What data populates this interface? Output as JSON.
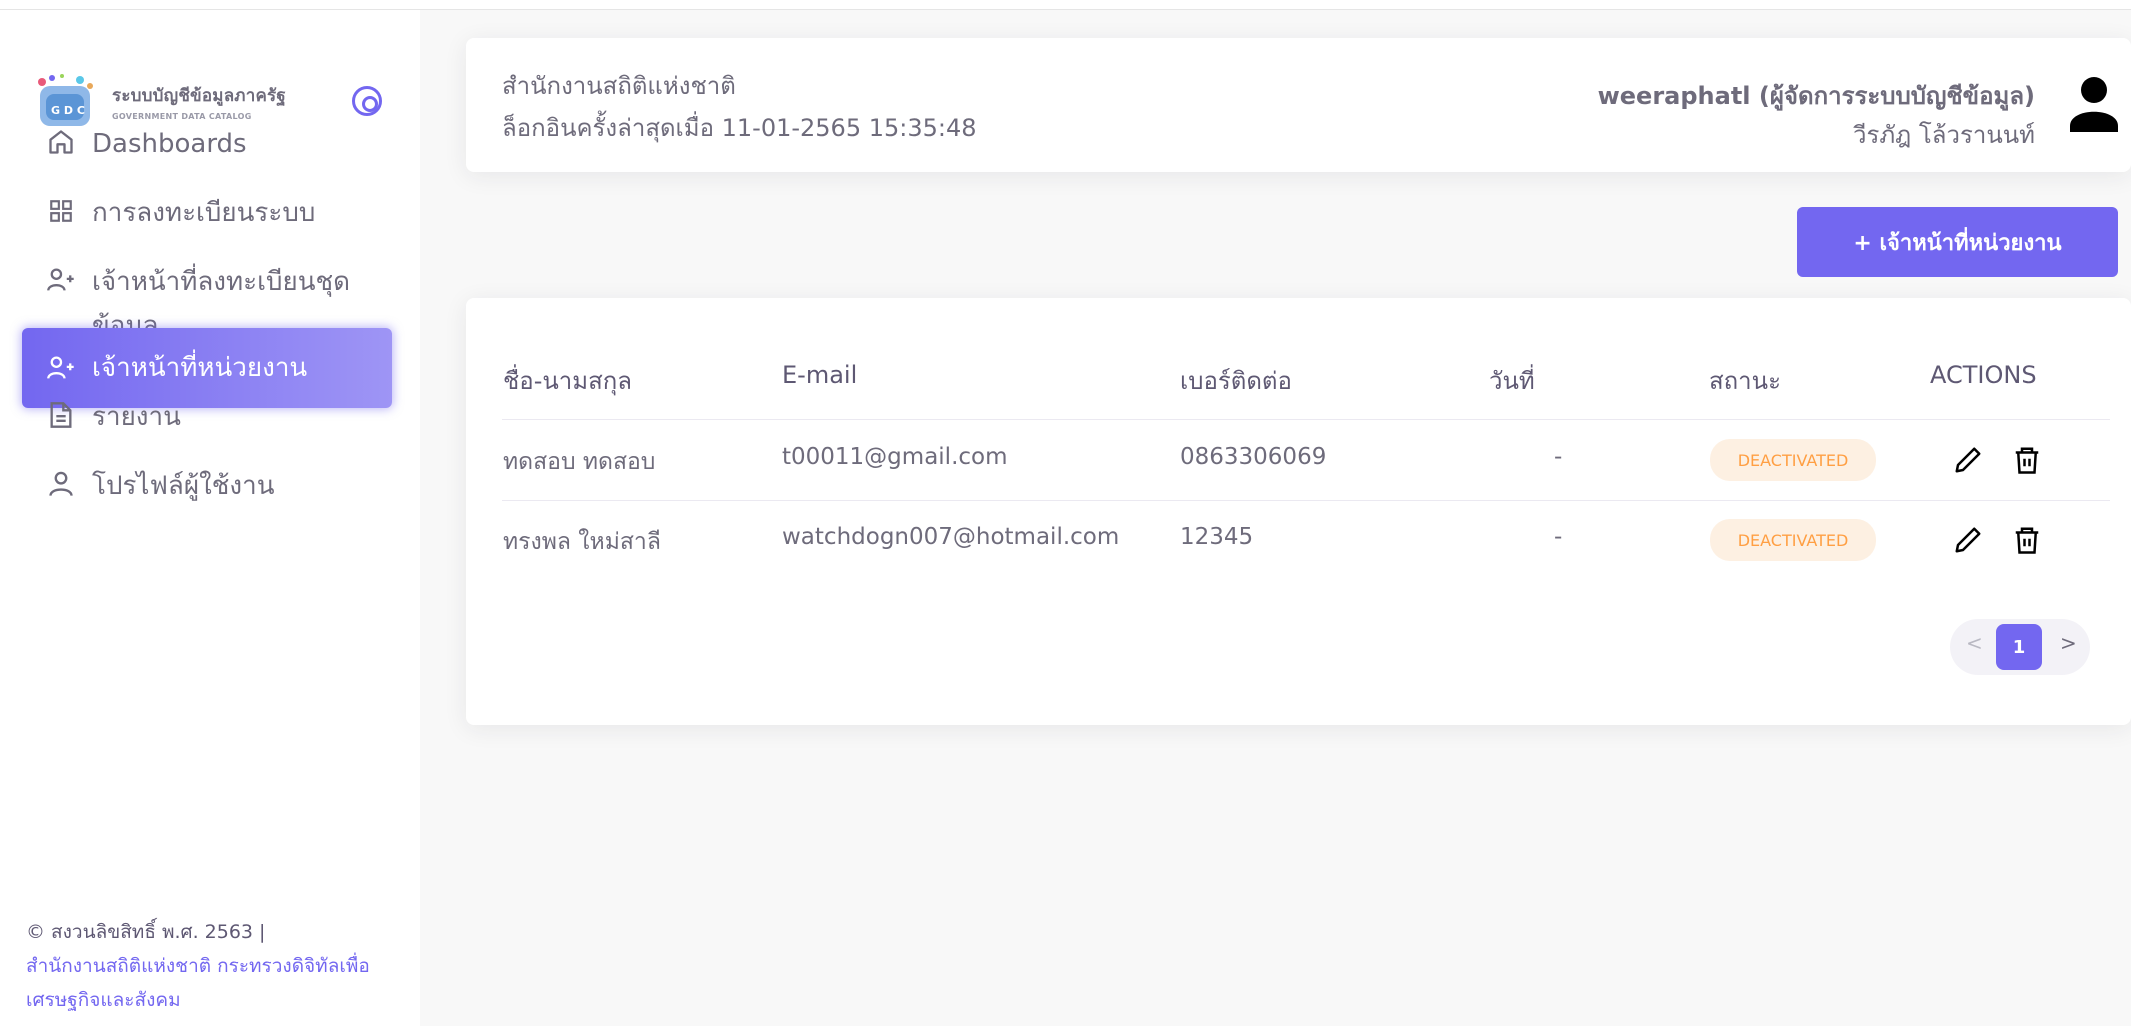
{
  "sidebar": {
    "brand_title": "ระบบบัญชีข้อมูลภาครัฐ",
    "brand_subtitle": "GOVERNMENT DATA CATALOG",
    "logo_letters": "G D C",
    "items": [
      {
        "label": "Dashboards",
        "icon": "home-icon"
      },
      {
        "label": "การลงทะเบียนระบบ",
        "icon": "grid-icon"
      },
      {
        "label_line1": "เจ้าหน้าที่ลงทะเบียนชุด",
        "label_line2": "ข้อมูล",
        "icon": "user-plus-icon"
      },
      {
        "label": "เจ้าหน้าที่หน่วยงาน",
        "icon": "user-plus-icon",
        "active": true
      },
      {
        "label": "รายงาน",
        "icon": "file-text-icon"
      },
      {
        "label": "โปรไฟล์ผู้ใช้งาน",
        "icon": "user-icon"
      }
    ],
    "footer_copyright": "© สงวนลิขสิทธิ์ พ.ศ. 2563 |",
    "footer_link_line1": "สำนักงานสถิติแห่งชาติ กระทรวงดิจิทัลเพื่อ",
    "footer_link_line2": "เศรษฐกิจและสังคม"
  },
  "header": {
    "org_name": "สำนักงานสถิติแห่งชาติ",
    "last_login": "ล็อกอินครั้งล่าสุดเมื่อ 11-01-2565 15:35:48",
    "user_name": "weeraphatl (ผู้จัดการระบบบัญชีข้อมูล)",
    "user_fullname": "วีรภัฎ โล้วรานนท์"
  },
  "add_button_label": "+ เจ้าหน้าที่หน่วยงาน",
  "table": {
    "columns": [
      "ชื่อ-นามสกุล",
      "E-mail",
      "เบอร์ติดต่อ",
      "วันที่",
      "สถานะ",
      "ACTIONS"
    ],
    "rows": [
      {
        "name": "ทดสอบ ทดสอบ",
        "email": "t00011@gmail.com",
        "phone": "0863306069",
        "date": "-",
        "status": "DEACTIVATED"
      },
      {
        "name": "ทรงพล ใหม่สาลี",
        "email": "watchdogn007@hotmail.com",
        "phone": "12345",
        "date": "-",
        "status": "DEACTIVATED"
      }
    ]
  },
  "pagination": {
    "prev": "<",
    "current": "1",
    "next": ">"
  },
  "colors": {
    "accent": "#7367f0",
    "warning": "#ff9f43",
    "warning_bg": "#fdf0e2"
  }
}
